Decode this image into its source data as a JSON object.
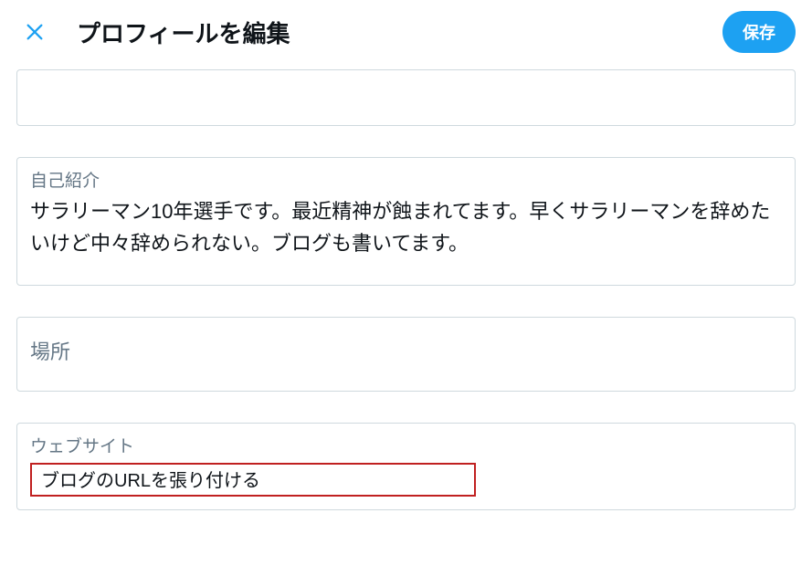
{
  "header": {
    "title": "プロフィールを編集",
    "save_label": "保存"
  },
  "fields": {
    "bio": {
      "label": "自己紹介",
      "value": "サラリーマン10年選手です。最近精神が蝕まれてます。早くサラリーマンを辞めたいけど中々辞められない。ブログも書いてます。"
    },
    "location": {
      "label": "場所",
      "value": ""
    },
    "website": {
      "label": "ウェブサイト",
      "value": "ブログのURLを張り付ける"
    }
  }
}
